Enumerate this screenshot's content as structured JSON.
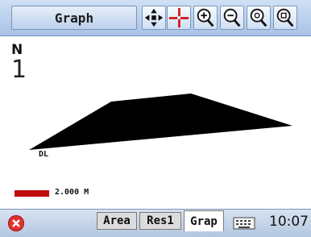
{
  "toolbar": {
    "title": "Graph",
    "tools": [
      {
        "icon": "pan-icon"
      },
      {
        "icon": "crosshair-icon"
      },
      {
        "icon": "zoom-in-icon"
      },
      {
        "icon": "zoom-out-icon"
      },
      {
        "icon": "zoom-extents-icon"
      },
      {
        "icon": "zoom-window-icon"
      }
    ]
  },
  "canvas": {
    "north_letter": "N",
    "north_value": "1",
    "shape_label": "DL",
    "scale_label": "2.000 M",
    "scale_color": "#c20d0d",
    "shape_color": "#000000"
  },
  "bottom": {
    "tabs": [
      "Area",
      "Res1",
      "Grap"
    ],
    "active_tab": "Grap",
    "time": "10:07"
  }
}
